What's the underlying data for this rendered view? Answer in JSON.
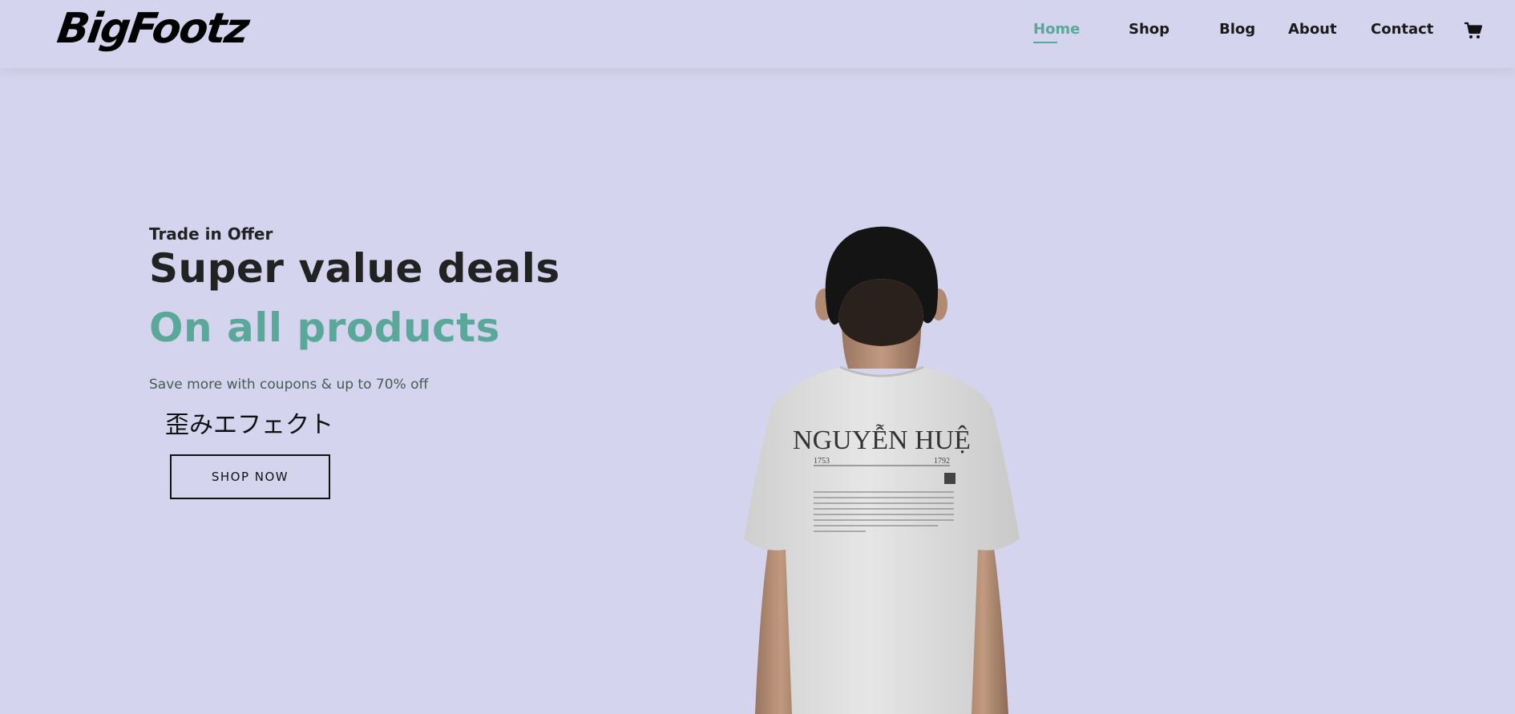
{
  "brand": {
    "logo_text": "BigFootz"
  },
  "nav": {
    "items": [
      {
        "label": "Home",
        "active": true
      },
      {
        "label": "Shop",
        "active": false
      },
      {
        "label": "Blog",
        "active": false
      },
      {
        "label": "About",
        "active": false
      },
      {
        "label": "Contact",
        "active": false
      }
    ],
    "cart_icon": "shopping-cart-icon"
  },
  "hero": {
    "kicker": "Trade in Offer",
    "headline": "Super value deals",
    "subheadline": "On all products",
    "description": "Save more with coupons & up to 70% off",
    "japanese_text": "歪みエフェクト",
    "button_label": "SHOP NOW",
    "shirt_print": {
      "name": "NGUYỄN HUỆ",
      "year_left": "1753",
      "year_right": "1792"
    }
  },
  "colors": {
    "background": "#d5d4ee",
    "accent": "#5aa89a",
    "text_dark": "#222222"
  }
}
